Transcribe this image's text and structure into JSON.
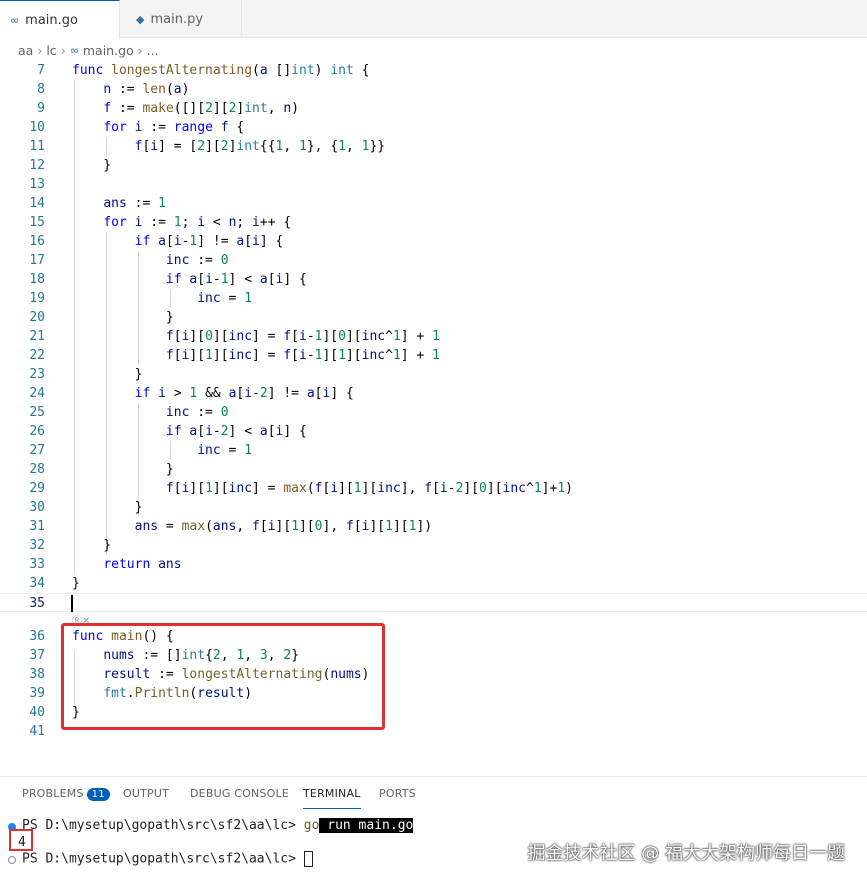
{
  "tabs": [
    {
      "label": "main.go",
      "icon": "go-file-icon",
      "active": true
    },
    {
      "label": "main.py",
      "icon": "python-file-icon",
      "active": false
    }
  ],
  "breadcrumb": [
    "aa",
    "lc",
    "main.go",
    "..."
  ],
  "editor": {
    "codelens": "Ⓡ✕"
  },
  "panel": {
    "tabs": {
      "problems": "PROBLEMS",
      "problems_count": "11",
      "output": "OUTPUT",
      "debug_console": "DEBUG CONSOLE",
      "terminal": "TERMINAL",
      "ports": "PORTS"
    },
    "terminal": {
      "prompt1": "PS D:\\mysetup\\gopath\\src\\sf2\\aa\\lc> ",
      "cmd_go": "go",
      "cmd_rest": " run main.go",
      "output": "4",
      "prompt2": "PS D:\\mysetup\\gopath\\src\\sf2\\aa\\lc> "
    },
    "watermark": "掘金技术社区 @ 福大大架构师每日一题"
  },
  "colors": {
    "keyword": "#0000ff",
    "function": "#795e26",
    "type": "#267f99",
    "number": "#098658",
    "highlight_box": "#e03131",
    "accent": "#005fb8"
  }
}
